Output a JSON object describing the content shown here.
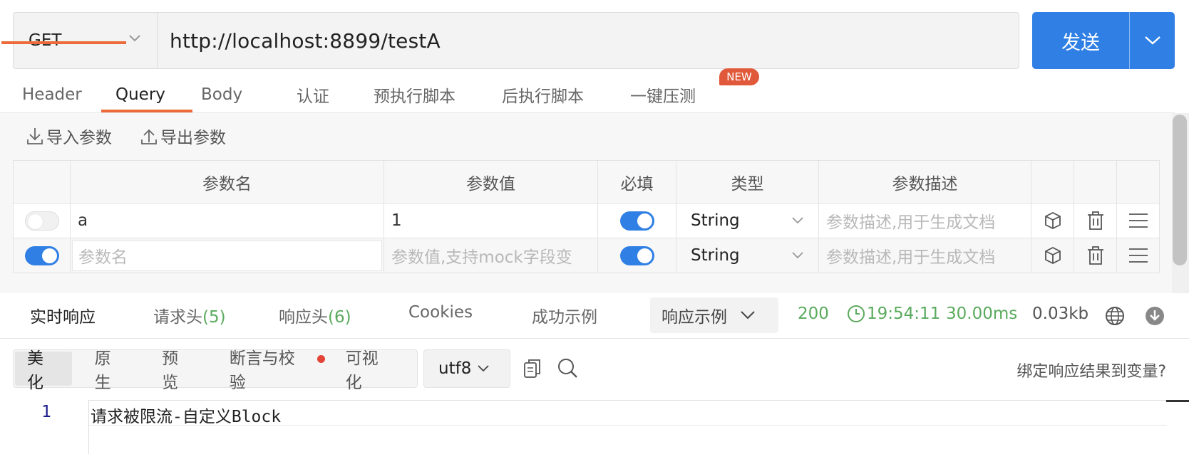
{
  "request": {
    "method": "GET",
    "url": "http://localhost:8899/testA",
    "send_label": "发送"
  },
  "tabs": [
    {
      "label": "Header"
    },
    {
      "label": "Query"
    },
    {
      "label": "Body"
    },
    {
      "label": "认证"
    },
    {
      "label": "预执行脚本"
    },
    {
      "label": "后执行脚本"
    },
    {
      "label": "一键压测"
    }
  ],
  "new_badge": "NEW",
  "params_toolbar": {
    "import_label": "导入参数",
    "export_label": "导出参数"
  },
  "params_table": {
    "headers": [
      "参数名",
      "参数值",
      "必填",
      "类型",
      "参数描述"
    ],
    "rows": [
      {
        "enabled": false,
        "name": "a",
        "value": "1",
        "required": true,
        "type": "String",
        "description_placeholder": "参数描述,用于生成文档"
      },
      {
        "enabled": true,
        "name_placeholder": "参数名",
        "value_placeholder": "参数值,支持mock字段变",
        "required": true,
        "type": "String",
        "description_placeholder": "参数描述,用于生成文档"
      }
    ]
  },
  "response_tabs": {
    "realtime": "实时响应",
    "req_headers": "请求头",
    "req_headers_count": "(5)",
    "resp_headers": "响应头",
    "resp_headers_count": "(6)",
    "cookies": "Cookies",
    "success_example": "成功示例",
    "example_dropdown": "响应示例"
  },
  "response_stats": {
    "status": "200",
    "time": "19:54:11",
    "duration": "30.00ms",
    "size": "0.03kb"
  },
  "format_tabs": [
    "美化",
    "原生",
    "预览",
    "断言与校验",
    "可视化"
  ],
  "encoding": "utf8",
  "bind_variable_label": "绑定响应结果到变量?",
  "editor": {
    "line_number": "1",
    "content": "请求被限流-自定义Block"
  },
  "colors": {
    "accent_blue": "#2f7fe4",
    "accent_orange": "#ed6b3a",
    "status_green": "#5aaa5d",
    "badge_red": "#e0593b"
  }
}
